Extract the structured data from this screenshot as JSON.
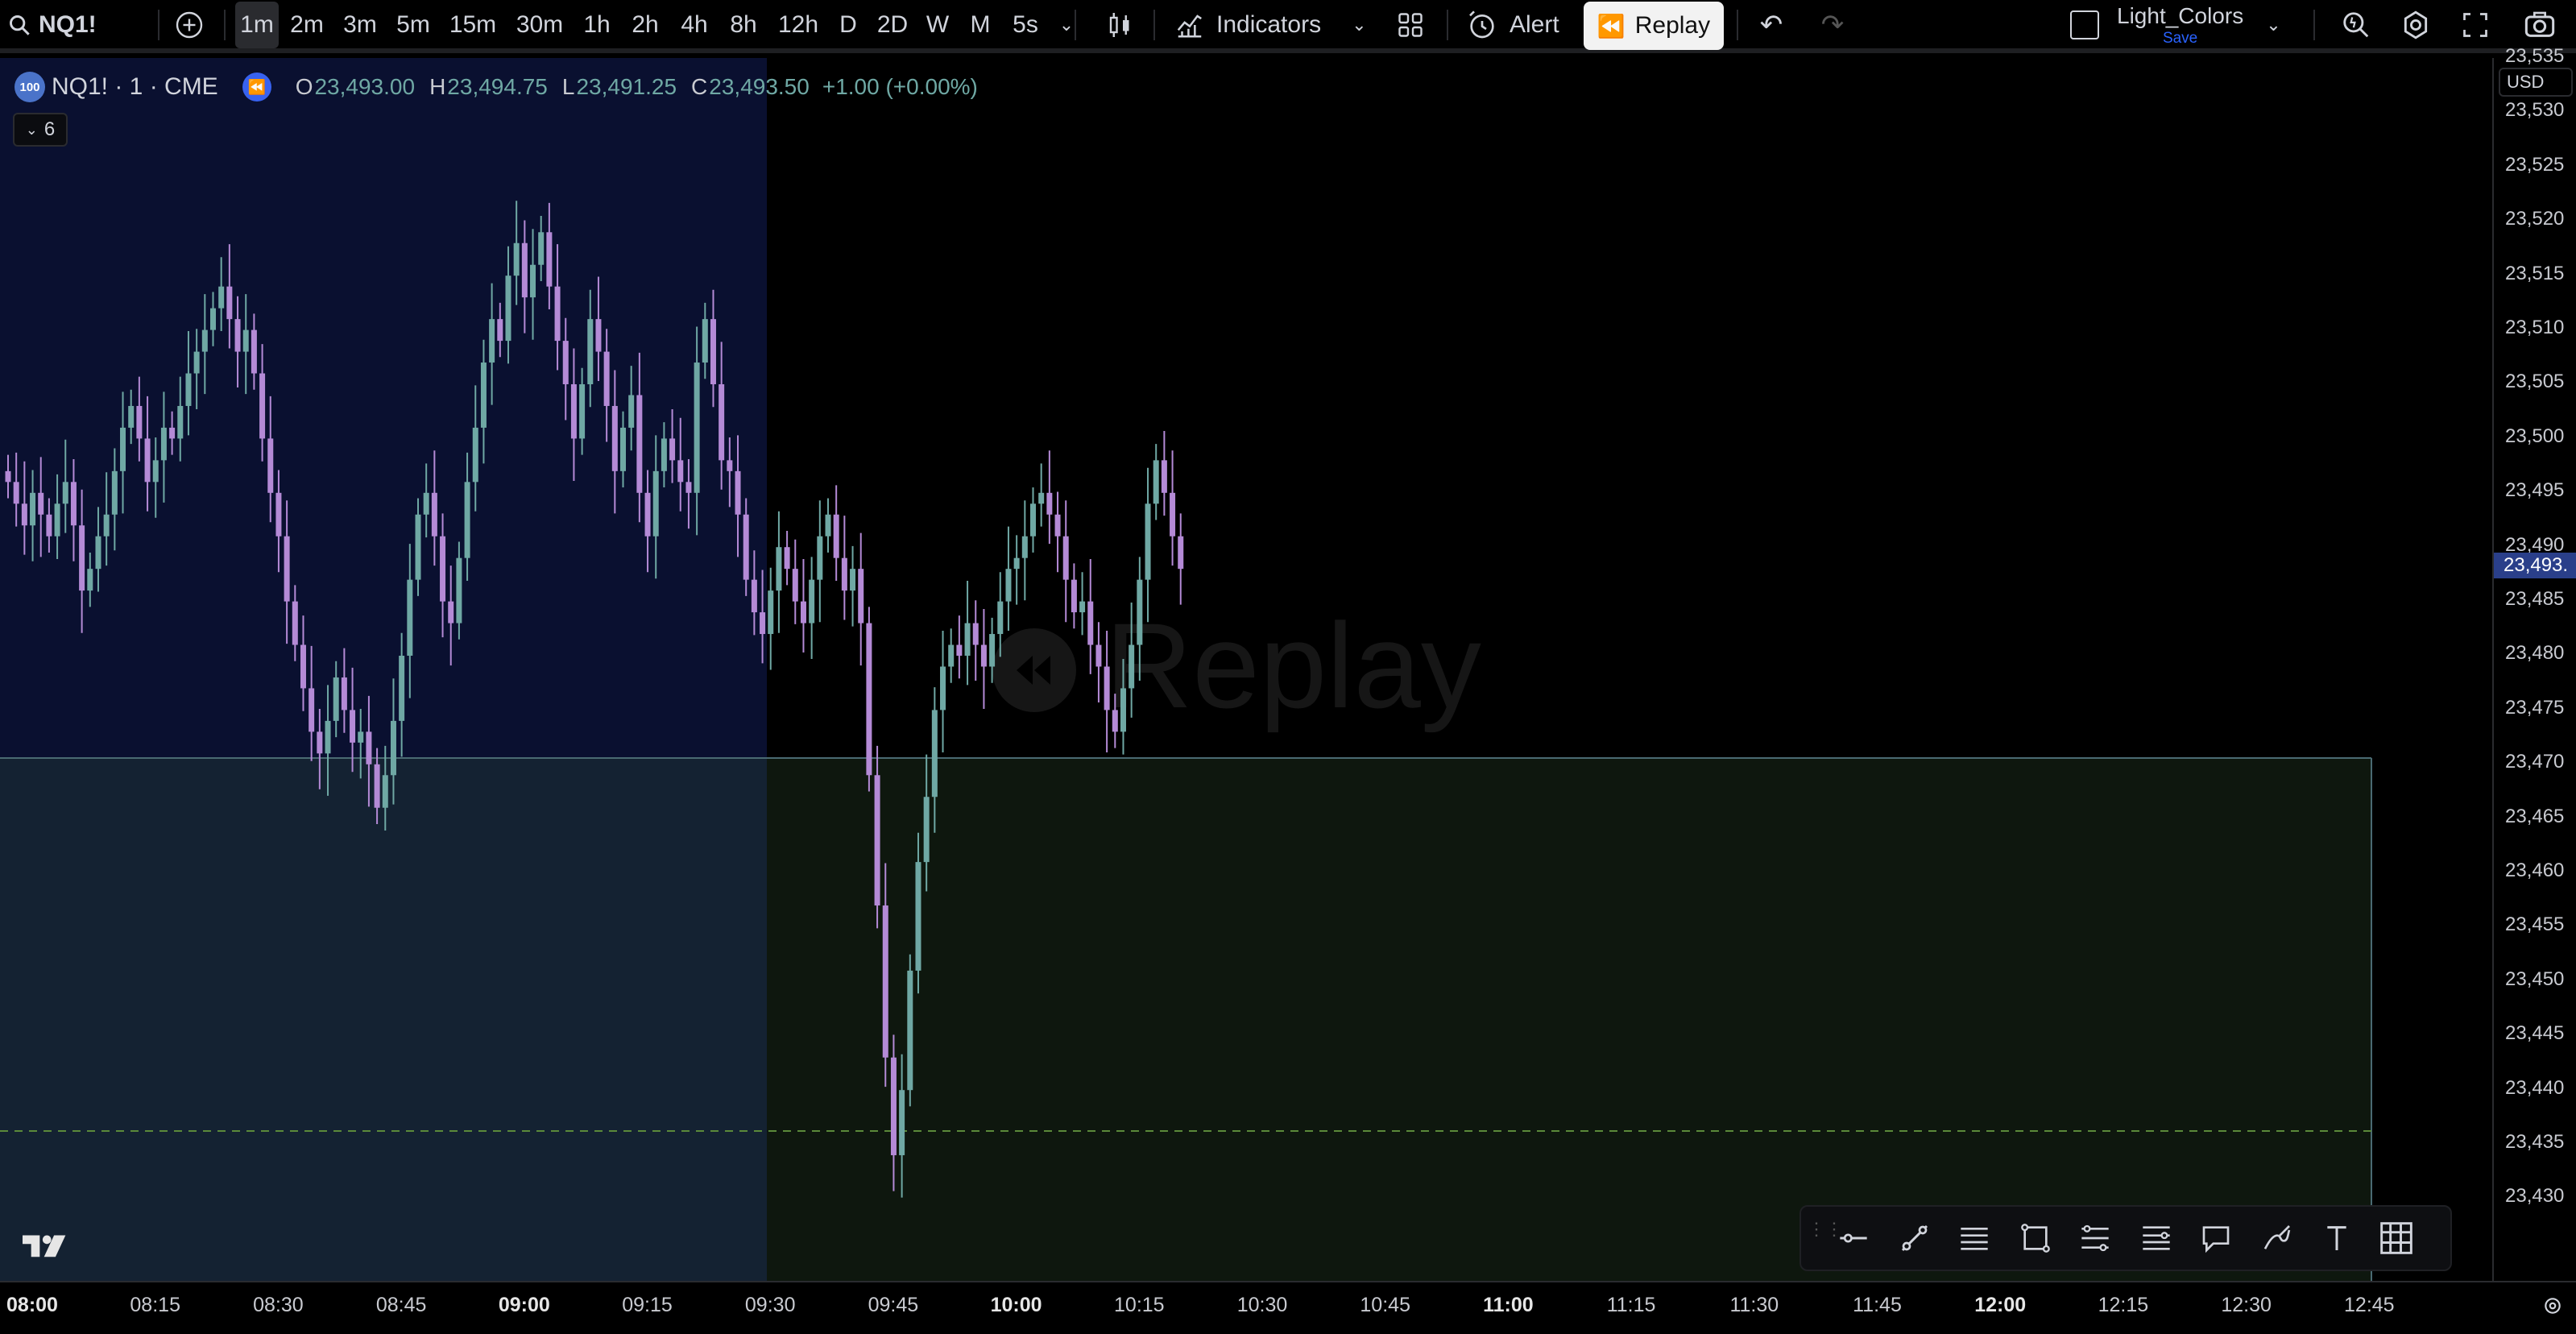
{
  "toolbar": {
    "symbol": "NQ1!",
    "intervals": [
      "1m",
      "2m",
      "3m",
      "5m",
      "15m",
      "30m",
      "1h",
      "2h",
      "4h",
      "8h",
      "12h",
      "D",
      "2D",
      "W",
      "M",
      "5s"
    ],
    "selected_interval": "1m",
    "indicators_label": "Indicators",
    "alert_label": "Alert",
    "replay_label": "Replay",
    "layout_name": "Light_Colors",
    "layout_save": "Save"
  },
  "legend": {
    "badge": "100",
    "symbol_line": "NQ1! · 1 · CME",
    "o_label": "O",
    "o_value": "23,493.00",
    "h_label": "H",
    "h_value": "23,494.75",
    "l_label": "L",
    "l_value": "23,491.25",
    "c_label": "C",
    "c_value": "23,493.50",
    "change": "+1.00 (+0.00%)",
    "collapse_count": "6"
  },
  "watermark": "Replay",
  "currency": "USD",
  "price_axis": [
    "23,535",
    "23,530",
    "23,525",
    "23,520",
    "23,515",
    "23,510",
    "23,505",
    "23,500",
    "23,495",
    "23,490",
    "23,485",
    "23,480",
    "23,475",
    "23,470",
    "23,465",
    "23,460",
    "23,455",
    "23,450",
    "23,445",
    "23,440",
    "23,435",
    "23,430"
  ],
  "last_price": "23,493.",
  "time_axis": [
    "08:00",
    "08:15",
    "08:30",
    "08:45",
    "09:00",
    "09:15",
    "09:30",
    "09:45",
    "10:00",
    "10:15",
    "10:30",
    "10:45",
    "11:00",
    "11:15",
    "11:30",
    "11:45",
    "12:00",
    "12:15",
    "12:30",
    "12:45"
  ],
  "bold_times": [
    "08:00",
    "09:00",
    "10:00",
    "11:00",
    "12:00"
  ],
  "colors": {
    "up": "#6fa8a4",
    "down": "#b48ad6",
    "session_bg": "#0a1030",
    "range_bg": "#0f1a0f",
    "accent": "#2962ff"
  },
  "chart_data": {
    "type": "candlestick",
    "x_unit": "minute",
    "x_start": "08:00",
    "y_range": [
      23428,
      23536
    ],
    "close_approx": [
      23501,
      23499,
      23497,
      23500,
      23498,
      23496,
      23499,
      23501,
      23497,
      23491,
      23493,
      23496,
      23498,
      23502,
      23506,
      23508,
      23505,
      23501,
      23503,
      23506,
      23505,
      23508,
      23511,
      23513,
      23515,
      23517,
      23519,
      23516,
      23513,
      23515,
      23511,
      23505,
      23500,
      23496,
      23490,
      23486,
      23482,
      23478,
      23476,
      23479,
      23483,
      23480,
      23477,
      23478,
      23475,
      23471,
      23474,
      23479,
      23485,
      23492,
      23498,
      23500,
      23496,
      23490,
      23488,
      23494,
      23501,
      23506,
      23512,
      23516,
      23514,
      23520,
      23523,
      23518,
      23521,
      23524,
      23519,
      23514,
      23510,
      23505,
      23510,
      23516,
      23513,
      23508,
      23502,
      23506,
      23509,
      23500,
      23496,
      23502,
      23505,
      23503,
      23501,
      23500,
      23512,
      23516,
      23510,
      23503,
      23502,
      23498,
      23492,
      23489,
      23487,
      23491,
      23495,
      23493,
      23490,
      23488,
      23492,
      23496,
      23498,
      23494,
      23491,
      23493,
      23488,
      23474,
      23462,
      23448,
      23439,
      23445,
      23456,
      23466,
      23472,
      23480,
      23484,
      23486,
      23485,
      23488,
      23486,
      23484,
      23487,
      23490,
      23493,
      23494,
      23496,
      23499,
      23500,
      23498,
      23496,
      23492,
      23489,
      23490,
      23486,
      23484,
      23480,
      23478,
      23482,
      23486,
      23492,
      23499,
      23503,
      23500,
      23496,
      23493
    ],
    "regions": [
      {
        "label": "session",
        "x_from": "08:00",
        "x_to": "09:30",
        "y_from": 23430,
        "y_to": 23536
      },
      {
        "label": "range",
        "x_from": "08:00",
        "x_to": "12:53",
        "y_from": 23430,
        "y_to": 23476
      }
    ],
    "horizontal_lines": [
      {
        "y": 23441.5,
        "style": "dashed"
      },
      {
        "y": 23476,
        "style": "solid"
      }
    ]
  }
}
